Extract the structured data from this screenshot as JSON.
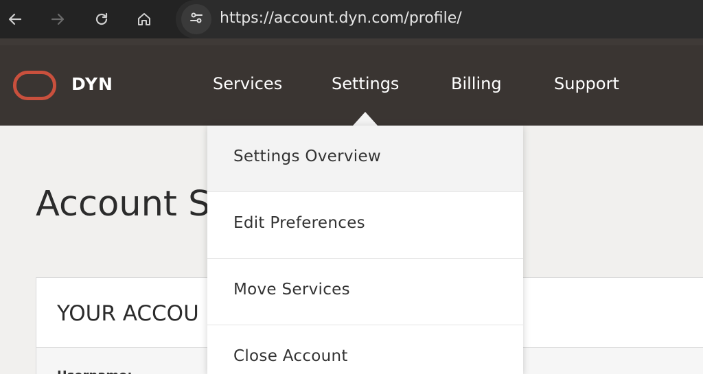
{
  "browser": {
    "url": "https://account.dyn.com/profile/",
    "icons": [
      "back-arrow-icon",
      "forward-arrow-icon",
      "reload-icon",
      "home-icon",
      "site-settings-icon"
    ]
  },
  "header": {
    "brand": "DYN",
    "menu": [
      {
        "label": "Services"
      },
      {
        "label": "Settings"
      },
      {
        "label": "Billing"
      },
      {
        "label": "Support"
      }
    ],
    "active_menu": "Settings"
  },
  "dropdown": {
    "items": [
      {
        "label": "Settings Overview",
        "active": true
      },
      {
        "label": "Edit Preferences"
      },
      {
        "label": "Move Services"
      },
      {
        "label": "Close Account"
      }
    ]
  },
  "page": {
    "title": "Account S",
    "card_title": "YOUR ACCOU",
    "row_label": "Username:"
  },
  "colors": {
    "header_bg": "#3a3532",
    "logo_accent": "#c9503d",
    "browser_bg": "#232323",
    "page_bg": "#f1f0ee"
  }
}
